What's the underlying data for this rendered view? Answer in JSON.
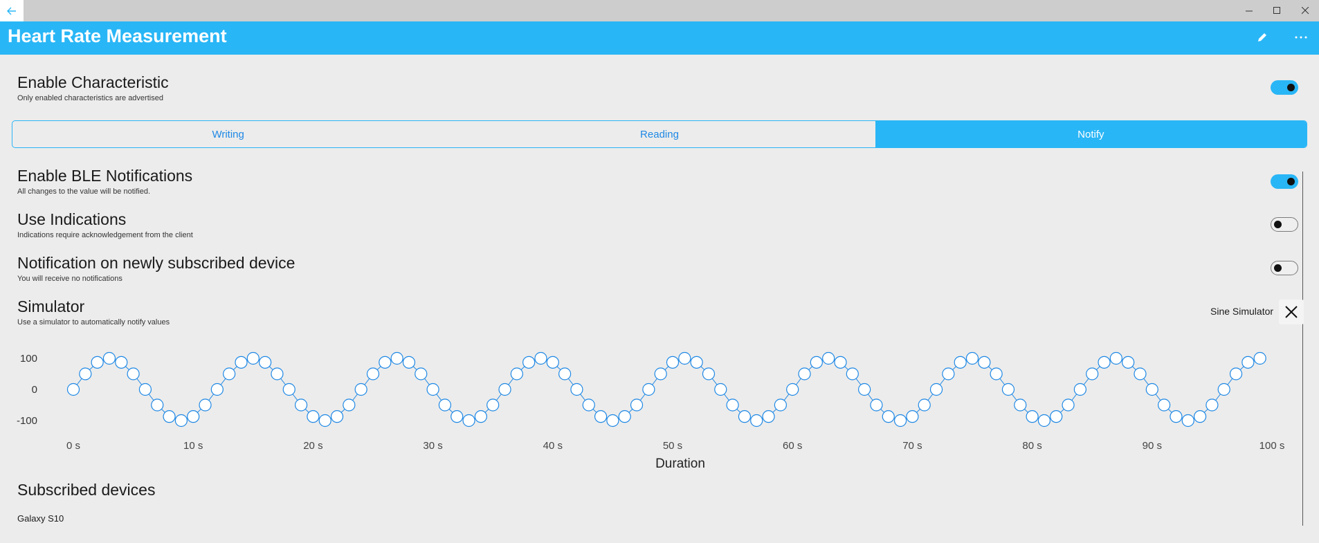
{
  "window": {
    "back_icon": "arrow-left-icon",
    "min_icon": "minimize-icon",
    "max_icon": "maximize-icon",
    "close_icon": "close-icon"
  },
  "appbar": {
    "title": "Heart Rate Measurement",
    "edit_icon": "pencil-icon",
    "more_icon": "more-horizontal-icon"
  },
  "enable_characteristic": {
    "title": "Enable Characteristic",
    "subtitle": "Only enabled characteristics are advertised",
    "on": true
  },
  "tabs": [
    {
      "label": "Writing",
      "active": false
    },
    {
      "label": "Reading",
      "active": false
    },
    {
      "label": "Notify",
      "active": true
    }
  ],
  "settings": [
    {
      "title": "Enable BLE Notifications",
      "subtitle": "All changes to the value will be notified.",
      "on": true
    },
    {
      "title": "Use Indications",
      "subtitle": "Indications require acknowledgement from the client",
      "on": false
    },
    {
      "title": "Notification on newly subscribed device",
      "subtitle": "You will receive no notifications",
      "on": false
    }
  ],
  "simulator": {
    "title": "Simulator",
    "subtitle": "Use a simulator to automatically notify values",
    "selected": "Sine Simulator",
    "clear_icon": "close-x-icon"
  },
  "chart_data": {
    "type": "scatter",
    "xlabel": "Duration",
    "ylabel": "",
    "xlim": [
      0,
      100
    ],
    "ylim": [
      -100,
      100
    ],
    "x_ticks": [
      "0 s",
      "10 s",
      "20 s",
      "30 s",
      "40 s",
      "50 s",
      "60 s",
      "70 s",
      "80 s",
      "90 s",
      "100 s"
    ],
    "y_ticks": [
      "100",
      "0",
      "-100"
    ],
    "series": [
      {
        "x": [
          0,
          1,
          2,
          3,
          4,
          5,
          6,
          7,
          8,
          9,
          10,
          11,
          12,
          13,
          14,
          15,
          16,
          17,
          18,
          19,
          20,
          21,
          22,
          23,
          24,
          25,
          26,
          27,
          28,
          29,
          30,
          31,
          32,
          33,
          34,
          35,
          36,
          37,
          38,
          39,
          40,
          41,
          42,
          43,
          44,
          45,
          46,
          47,
          48,
          49,
          50,
          51,
          52,
          53,
          54,
          55,
          56,
          57,
          58,
          59,
          60,
          61,
          62,
          63,
          64,
          65,
          66,
          67,
          68,
          69,
          70,
          71,
          72,
          73,
          74,
          75,
          76,
          77,
          78,
          79,
          80,
          81,
          82,
          83,
          84,
          85,
          86,
          87,
          88,
          89,
          90,
          91,
          92,
          93,
          94,
          95,
          96,
          97,
          98,
          99
        ],
        "y": [
          0,
          50,
          87,
          100,
          87,
          50,
          0,
          -50,
          -87,
          -100,
          -87,
          -50,
          0,
          50,
          87,
          100,
          87,
          50,
          0,
          -50,
          -87,
          -100,
          -87,
          -50,
          0,
          50,
          87,
          100,
          87,
          50,
          0,
          -50,
          -87,
          -100,
          -87,
          -50,
          0,
          50,
          87,
          100,
          87,
          50,
          0,
          -50,
          -87,
          -100,
          -87,
          -50,
          0,
          50,
          87,
          100,
          87,
          50,
          0,
          -50,
          -87,
          -100,
          -87,
          -50,
          0,
          50,
          87,
          100,
          87,
          50,
          0,
          -50,
          -87,
          -100,
          -87,
          -50,
          0,
          50,
          87,
          100,
          87,
          50,
          0,
          -50,
          -87,
          -100,
          -87,
          -50,
          0,
          50,
          87,
          100,
          87,
          50,
          0,
          -50,
          -87,
          -100,
          -87,
          -50,
          0,
          50,
          87,
          100
        ]
      }
    ],
    "color": "#1e88e5",
    "grid": false,
    "legend": "none"
  },
  "subscribed": {
    "title": "Subscribed devices",
    "devices": [
      "Galaxy S10"
    ]
  },
  "colors": {
    "accent": "#29b6f6",
    "titlebar": "#cdcdcd",
    "background": "#ececec"
  }
}
